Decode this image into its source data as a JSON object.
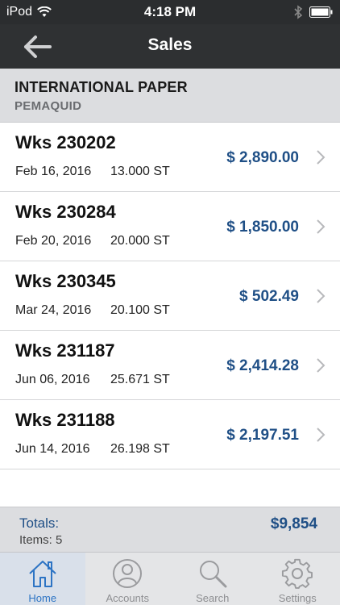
{
  "status_bar": {
    "carrier": "iPod",
    "time": "4:18 PM",
    "wifi_icon": "wifi-icon",
    "bluetooth_icon": "bluetooth-icon",
    "battery_icon": "battery-icon"
  },
  "nav": {
    "title": "Sales",
    "back_icon": "arrow-left-icon"
  },
  "account": {
    "name": "INTERNATIONAL PAPER",
    "location": "PEMAQUID"
  },
  "sales": [
    {
      "wks": "Wks 230202",
      "date": "Feb 16, 2016",
      "qty": "13.000 ST",
      "amount": "$ 2,890.00"
    },
    {
      "wks": "Wks 230284",
      "date": "Feb 20, 2016",
      "qty": "20.000 ST",
      "amount": "$ 1,850.00"
    },
    {
      "wks": "Wks 230345",
      "date": "Mar 24, 2016",
      "qty": "20.100 ST",
      "amount": "$ 502.49"
    },
    {
      "wks": "Wks 231187",
      "date": "Jun 06, 2016",
      "qty": "25.671 ST",
      "amount": "$ 2,414.28"
    },
    {
      "wks": "Wks 231188",
      "date": "Jun 14, 2016",
      "qty": "26.198 ST",
      "amount": "$ 2,197.51"
    }
  ],
  "totals": {
    "label": "Totals:",
    "items_label": "Items:  5",
    "total": "$9,854"
  },
  "tabs": [
    {
      "label": "Home",
      "icon": "home-icon",
      "active": true
    },
    {
      "label": "Accounts",
      "icon": "user-icon",
      "active": false
    },
    {
      "label": "Search",
      "icon": "search-icon",
      "active": false
    },
    {
      "label": "Settings",
      "icon": "gear-icon",
      "active": false
    }
  ],
  "colors": {
    "accent": "#1f4f86",
    "tab_active": "#2d74c4",
    "nav_bg": "#2f3133"
  }
}
